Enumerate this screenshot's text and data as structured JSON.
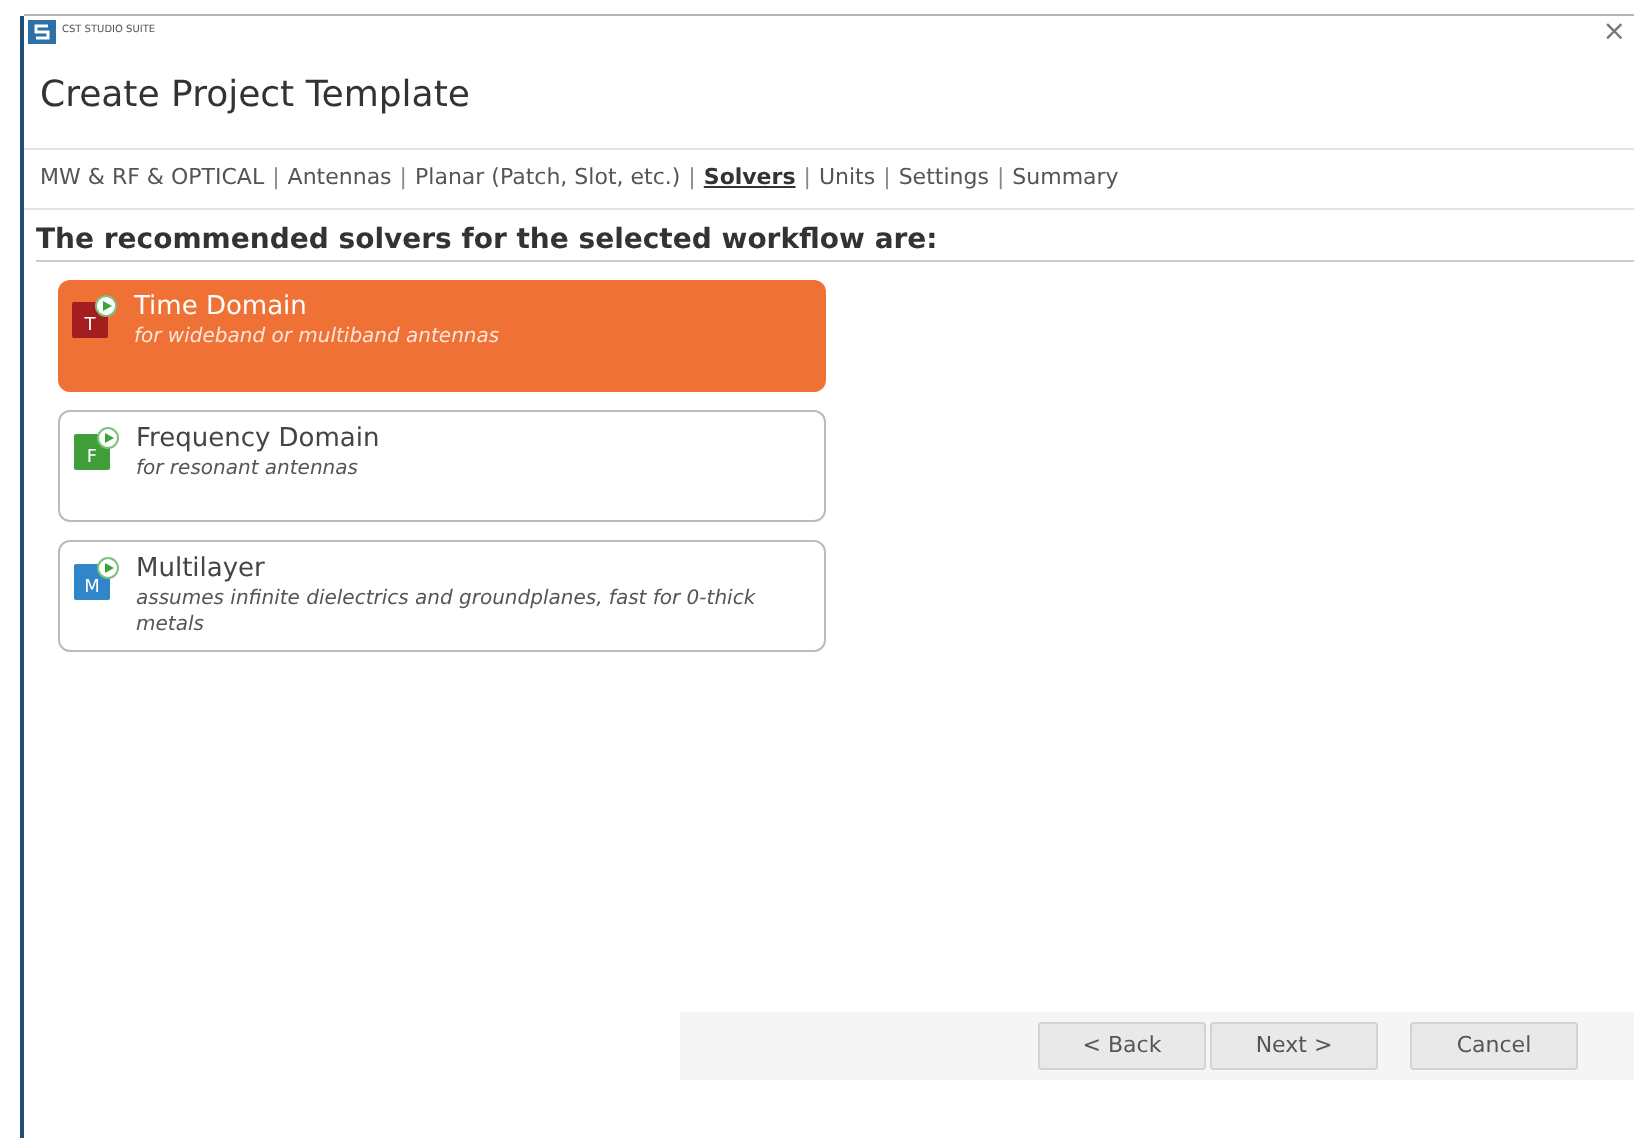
{
  "window": {
    "brand": "CST STUDIO SUITE",
    "close": "×",
    "title": "Create Project Template"
  },
  "breadcrumb": {
    "separator": "|",
    "items": [
      {
        "label": "MW & RF & OPTICAL",
        "selected": false
      },
      {
        "label": "Antennas",
        "selected": false
      },
      {
        "label": "Planar (Patch, Slot, etc.)",
        "selected": false
      },
      {
        "label": "Solvers",
        "selected": true
      },
      {
        "label": "Units",
        "selected": false
      },
      {
        "label": "Settings",
        "selected": false
      },
      {
        "label": "Summary",
        "selected": false
      }
    ]
  },
  "heading": "The recommended solvers for the selected workflow are:",
  "solvers": [
    {
      "name": "Time Domain",
      "description": "for wideband or multiband antennas",
      "letter": "T",
      "color": "#a31f1f",
      "selected": true
    },
    {
      "name": "Frequency Domain",
      "description": "for resonant antennas",
      "letter": "F",
      "color": "#3f9e3a",
      "selected": false
    },
    {
      "name": "Multilayer",
      "description": "assumes infinite dielectrics and groundplanes, fast for 0-thick metals",
      "letter": "M",
      "color": "#2f86c8",
      "selected": false
    }
  ],
  "buttons": [
    "< Back",
    "Next >",
    "Cancel"
  ]
}
